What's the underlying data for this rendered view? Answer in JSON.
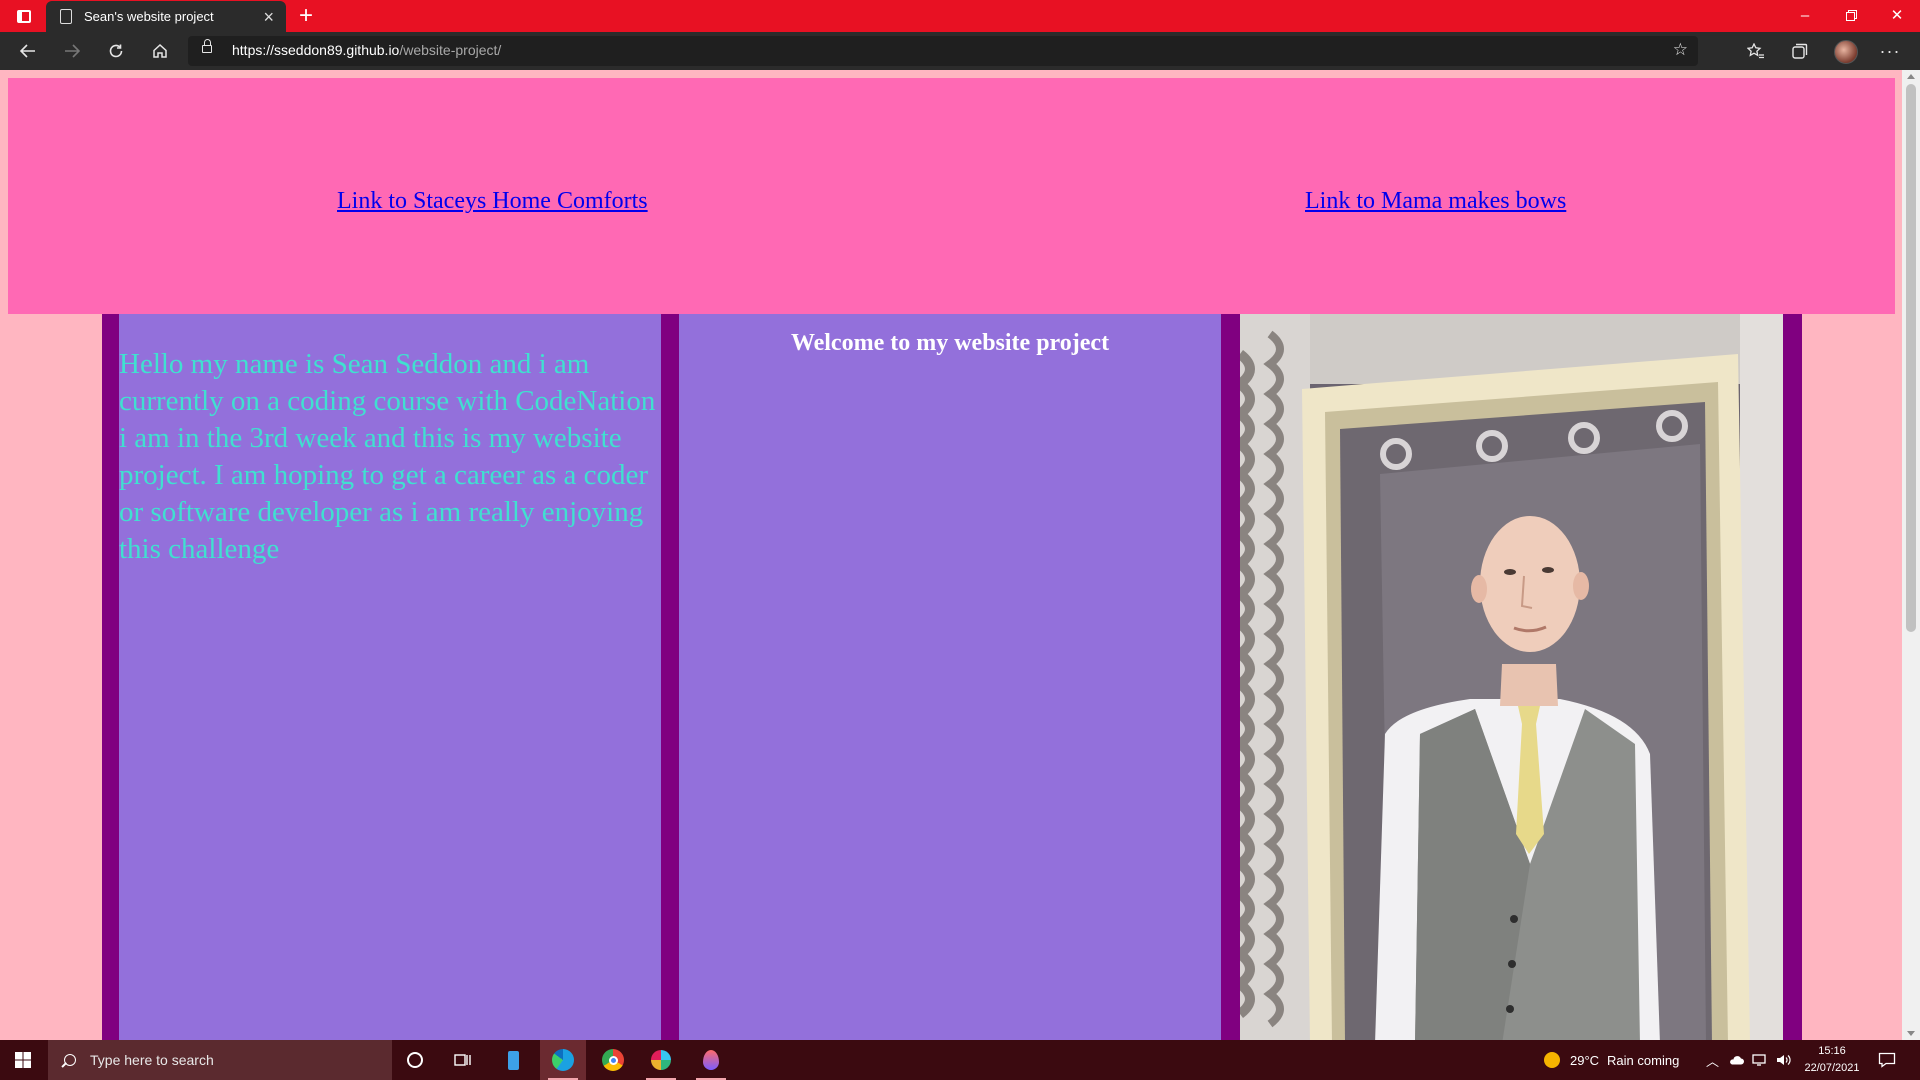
{
  "browser": {
    "tab_title": "Sean's website project",
    "url_host": "https://sseddon89.github.io",
    "url_path": "/website-project/"
  },
  "page": {
    "header_links": [
      "Link to Staceys Home Comforts",
      "Link to Mama makes bows"
    ],
    "intro_text": "Hello my name is Sean Seddon and i am currently on a coding course with CodeNation i am in the 3rd week and this is my website project. I am hoping to get a career as a coder or software developer as i am really enjoying this challenge",
    "welcome_heading": "Welcome to my website project"
  },
  "taskbar": {
    "search_placeholder": "Type here to search",
    "temperature": "29°C",
    "weather": "Rain coming",
    "time": "15:16",
    "date": "22/07/2021"
  },
  "colors": {
    "titlebar": "#e81123",
    "page_background": "#ffb6c1",
    "header_background": "#ff69b4",
    "column_background": "#9370db",
    "column_border": "#800080",
    "intro_text": "#40e0d0",
    "link": "#0000ee"
  }
}
